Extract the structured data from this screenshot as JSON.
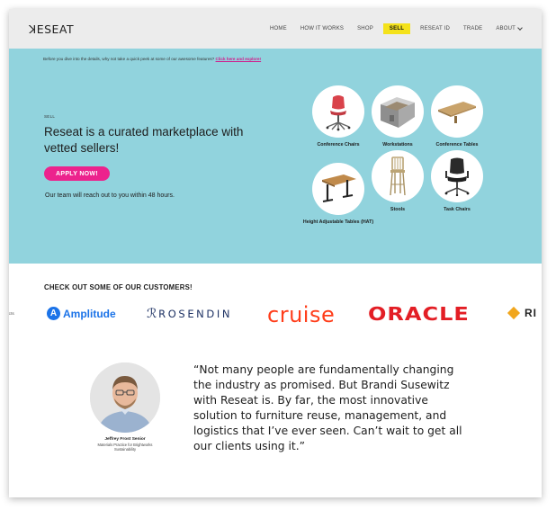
{
  "header": {
    "logo": "ꓘESEAT",
    "nav": [
      {
        "label": "HOME"
      },
      {
        "label": "HOW IT WORKS"
      },
      {
        "label": "SHOP"
      },
      {
        "label": "SELL",
        "active": true
      },
      {
        "label": "RESEAT ID"
      },
      {
        "label": "TRADE"
      },
      {
        "label": "ABOUT"
      }
    ]
  },
  "hero": {
    "intro_text": "Before you dive into the details, why not take a quick peek at some of our awesome features?",
    "intro_link": "Click here and explore!",
    "tag": "SELL",
    "headline": "Reseat is a curated marketplace with vetted sellers!",
    "cta": "APPLY NOW!",
    "note": "Our team will reach out to you within 48 hours.",
    "categories": [
      {
        "label": "Conference Chairs",
        "icon": "conference-chair-icon"
      },
      {
        "label": "Workstations",
        "icon": "workstation-icon"
      },
      {
        "label": "Conference Tables",
        "icon": "conference-table-icon"
      },
      {
        "label": "Height Adjustable Tables (HAT)",
        "icon": "adjustable-table-icon"
      },
      {
        "label": "Stools",
        "icon": "stool-icon"
      },
      {
        "label": "Task Chairs",
        "icon": "task-chair-icon"
      }
    ]
  },
  "customers": {
    "title": "CHECK OUT SOME OF OUR CUSTOMERS!",
    "logos": {
      "cut_left": "ucts",
      "amplitude": "Amplitude",
      "rosendin": "ROSENDIN",
      "cruise": "cruise",
      "oracle": "ORACLE",
      "cut_right": "RI"
    }
  },
  "testimonial": {
    "quote": "“Not many people are fundamentally changing the industry as promised. But Brandi Susewitz with Reseat is. By far, the most innovative solution to furniture reuse, management, and logistics that I’ve ever seen. Can’t wait to get all our clients using it.”",
    "name": "Jeffrey Frost Senior",
    "role": "Materials Practice for Brightworks Sustainability"
  },
  "colors": {
    "hero_bg": "#91d3dd",
    "nav_active": "#f4e21b",
    "cta": "#ec238d",
    "link": "#d11a8a"
  }
}
